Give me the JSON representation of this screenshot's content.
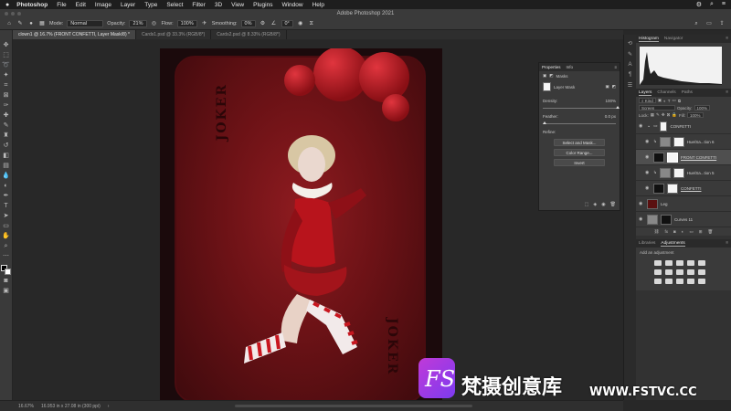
{
  "menubar": {
    "app_name": "Photoshop",
    "items": [
      "File",
      "Edit",
      "Image",
      "Layer",
      "Type",
      "Select",
      "Filter",
      "3D",
      "View",
      "Plugins",
      "Window",
      "Help"
    ]
  },
  "window": {
    "title": "Adobe Photoshop 2021"
  },
  "options_bar": {
    "mode_label": "Mode:",
    "mode_value": "Normal",
    "opacity_label": "Opacity:",
    "opacity_value": "21%",
    "flow_label": "Flow:",
    "flow_value": "100%",
    "smoothing_label": "Smoothing:",
    "smoothing_value": "0%",
    "angle_value": "0°"
  },
  "tabs": [
    {
      "label": "clown1 @ 16.7% (FRONT CONFETTI, Layer Mask/8) *",
      "active": true
    },
    {
      "label": "Cards1.psd @ 33.3% (RGB/8*)",
      "active": false
    },
    {
      "label": "Cards2.psd @ 8.33% (RGB/8*)",
      "active": false
    }
  ],
  "canvas": {
    "card_text": "JOKER",
    "card_text_top": "JOKER"
  },
  "status_bar": {
    "zoom": "16.67%",
    "doc_size": "16.953 in x 27.08 in (300 ppi)"
  },
  "properties": {
    "tabs": [
      "Properties",
      "Info"
    ],
    "section_label": "Masks",
    "layer_type": "Layer Mask",
    "density_label": "Density:",
    "density_value": "100%",
    "feather_label": "Feather:",
    "feather_value": "0.0 px",
    "refine_label": "Refine:",
    "buttons": [
      "Select and Mask...",
      "Color Range...",
      "Invert"
    ],
    "density_level": 1.0,
    "feather_level": 0.0
  },
  "histogram_panel": {
    "tabs": [
      "Histogram",
      "Navigator"
    ]
  },
  "layers_panel": {
    "tabs": [
      "Layers",
      "Channels",
      "Paths"
    ],
    "filter_label": "Kind",
    "blend_mode": "Screen",
    "opacity_label": "Opacity:",
    "opacity_value": "100%",
    "lock_label": "Lock:",
    "fill_label": "Fill:",
    "fill_value": "100%",
    "layers": [
      {
        "name": "CONFETTI",
        "type": "group",
        "selected": false
      },
      {
        "name": "Hue/Sa...tion 6",
        "type": "adjustment",
        "selected": false
      },
      {
        "name": "FRONT CONFETTI",
        "type": "layer",
        "selected": true
      },
      {
        "name": "Hue/Sa...tion 5",
        "type": "adjustment",
        "selected": false
      },
      {
        "name": "CONFETTI",
        "type": "layer",
        "selected": false
      },
      {
        "name": "Leg",
        "type": "layer",
        "selected": false
      },
      {
        "name": "Curves 11",
        "type": "adjustment",
        "selected": false
      }
    ]
  },
  "adjustments_panel": {
    "tabs": [
      "Libraries",
      "Adjustments"
    ],
    "add_label": "Add an adjustment"
  },
  "watermark": {
    "text_cn": "梵摄创意库",
    "url": "WWW.FSTVC.CC"
  },
  "colors": {
    "accent_magenta": "#c03ad8",
    "card_red": "#7a1418",
    "panel_bg": "#3a3a3a"
  }
}
